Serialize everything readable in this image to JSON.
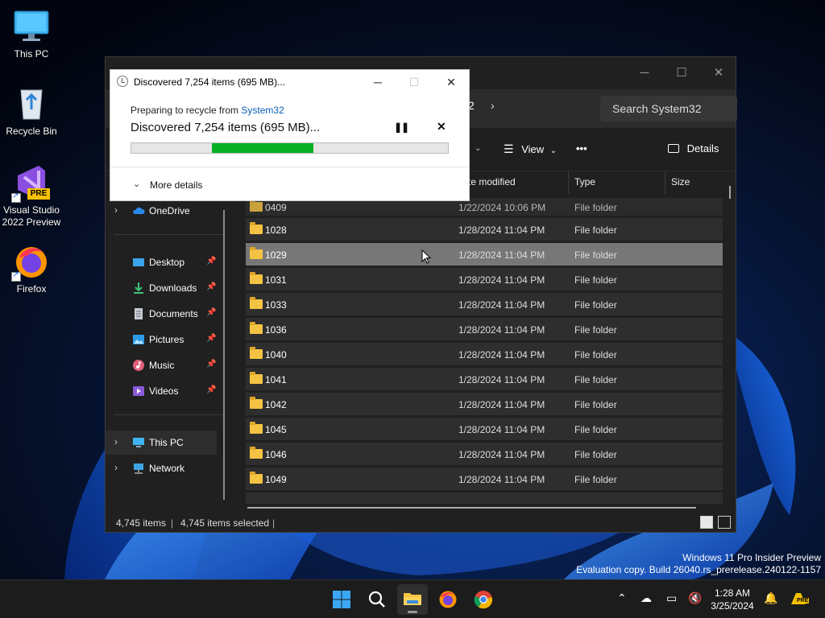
{
  "desktop": {
    "icons": [
      {
        "label": "This PC"
      },
      {
        "label": "Recycle Bin"
      },
      {
        "label": "Visual Studio 2022 Preview",
        "badge": "PRE"
      },
      {
        "label": "Firefox"
      }
    ]
  },
  "explorer": {
    "breadcrumb_fragment": "2",
    "search_placeholder": "Search System32",
    "toolbar": {
      "view_label": "View",
      "more_label": "•••",
      "details_label": "Details"
    },
    "nav": [
      {
        "label": "OneDrive",
        "icon": "cloud-icon"
      },
      {
        "label": "Desktop",
        "icon": "desktop-icon"
      },
      {
        "label": "Downloads",
        "icon": "download-icon"
      },
      {
        "label": "Documents",
        "icon": "document-icon"
      },
      {
        "label": "Pictures",
        "icon": "picture-icon"
      },
      {
        "label": "Music",
        "icon": "music-icon"
      },
      {
        "label": "Videos",
        "icon": "video-icon"
      },
      {
        "label": "This PC",
        "icon": "monitor-icon"
      },
      {
        "label": "Network",
        "icon": "network-icon"
      }
    ],
    "columns": [
      "te modified",
      "Type",
      "Size"
    ],
    "rows": [
      {
        "name": "0409",
        "date": "1/22/2024 10:06 PM",
        "type": "File folder"
      },
      {
        "name": "1028",
        "date": "1/28/2024 11:04 PM",
        "type": "File folder"
      },
      {
        "name": "1029",
        "date": "1/28/2024 11:04 PM",
        "type": "File folder"
      },
      {
        "name": "1031",
        "date": "1/28/2024 11:04 PM",
        "type": "File folder"
      },
      {
        "name": "1033",
        "date": "1/28/2024 11:04 PM",
        "type": "File folder"
      },
      {
        "name": "1036",
        "date": "1/28/2024 11:04 PM",
        "type": "File folder"
      },
      {
        "name": "1040",
        "date": "1/28/2024 11:04 PM",
        "type": "File folder"
      },
      {
        "name": "1041",
        "date": "1/28/2024 11:04 PM",
        "type": "File folder"
      },
      {
        "name": "1042",
        "date": "1/28/2024 11:04 PM",
        "type": "File folder"
      },
      {
        "name": "1045",
        "date": "1/28/2024 11:04 PM",
        "type": "File folder"
      },
      {
        "name": "1046",
        "date": "1/28/2024 11:04 PM",
        "type": "File folder"
      },
      {
        "name": "1049",
        "date": "1/28/2024 11:04 PM",
        "type": "File folder"
      }
    ],
    "status": {
      "items": "4,745 items",
      "selected": "4,745 items selected"
    }
  },
  "dialog": {
    "title": "Discovered 7,254 items (695 MB)...",
    "preparing_prefix": "Preparing to recycle from",
    "source_folder": "System32",
    "main_text": "Discovered 7,254 items (695 MB)...",
    "pause_glyph": "❚❚",
    "cancel_glyph": "✕",
    "more_details": "More details",
    "progress_shown": "indeterminate",
    "progress_color": "#06b025"
  },
  "watermark": {
    "line1": "Windows 11 Pro Insider Preview",
    "line2": "Evaluation copy. Build 26040.rs_prerelease.240122-1157"
  },
  "taskbar": {
    "time": "1:28 AM",
    "date": "3/25/2024",
    "tray_badge": "PRE"
  }
}
